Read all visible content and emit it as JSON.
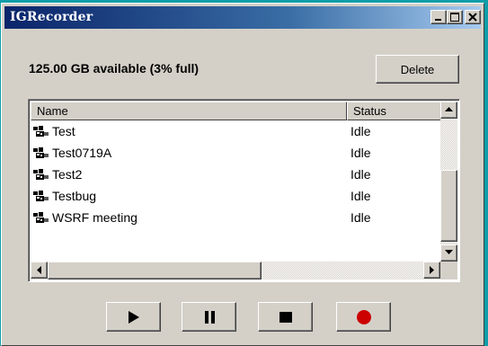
{
  "window": {
    "title": "IGRecorder",
    "controls": [
      "minimize-icon",
      "maximize-icon",
      "close-icon"
    ]
  },
  "storage": {
    "available_text": "125.00 GB available (3% full)"
  },
  "toolbar": {
    "delete_label": "Delete"
  },
  "list": {
    "columns": [
      "Name",
      "Status"
    ],
    "rows": [
      {
        "name": "Test",
        "status": "Idle",
        "icon": "recording-icon"
      },
      {
        "name": "Test0719A",
        "status": "Idle",
        "icon": "recording-icon"
      },
      {
        "name": "Test2",
        "status": "Idle",
        "icon": "recording-icon"
      },
      {
        "name": "Testbug",
        "status": "Idle",
        "icon": "recording-icon"
      },
      {
        "name": "WSRF meeting",
        "status": "Idle",
        "icon": "recording-icon"
      }
    ]
  },
  "controls": {
    "play": "play-icon",
    "pause": "pause-icon",
    "stop": "stop-icon",
    "record": "record-icon",
    "record_color": "#cc0000"
  },
  "colors": {
    "desktop": "#0f9ea9",
    "titlebar": "#0a246a",
    "face": "#d4d0c8"
  }
}
